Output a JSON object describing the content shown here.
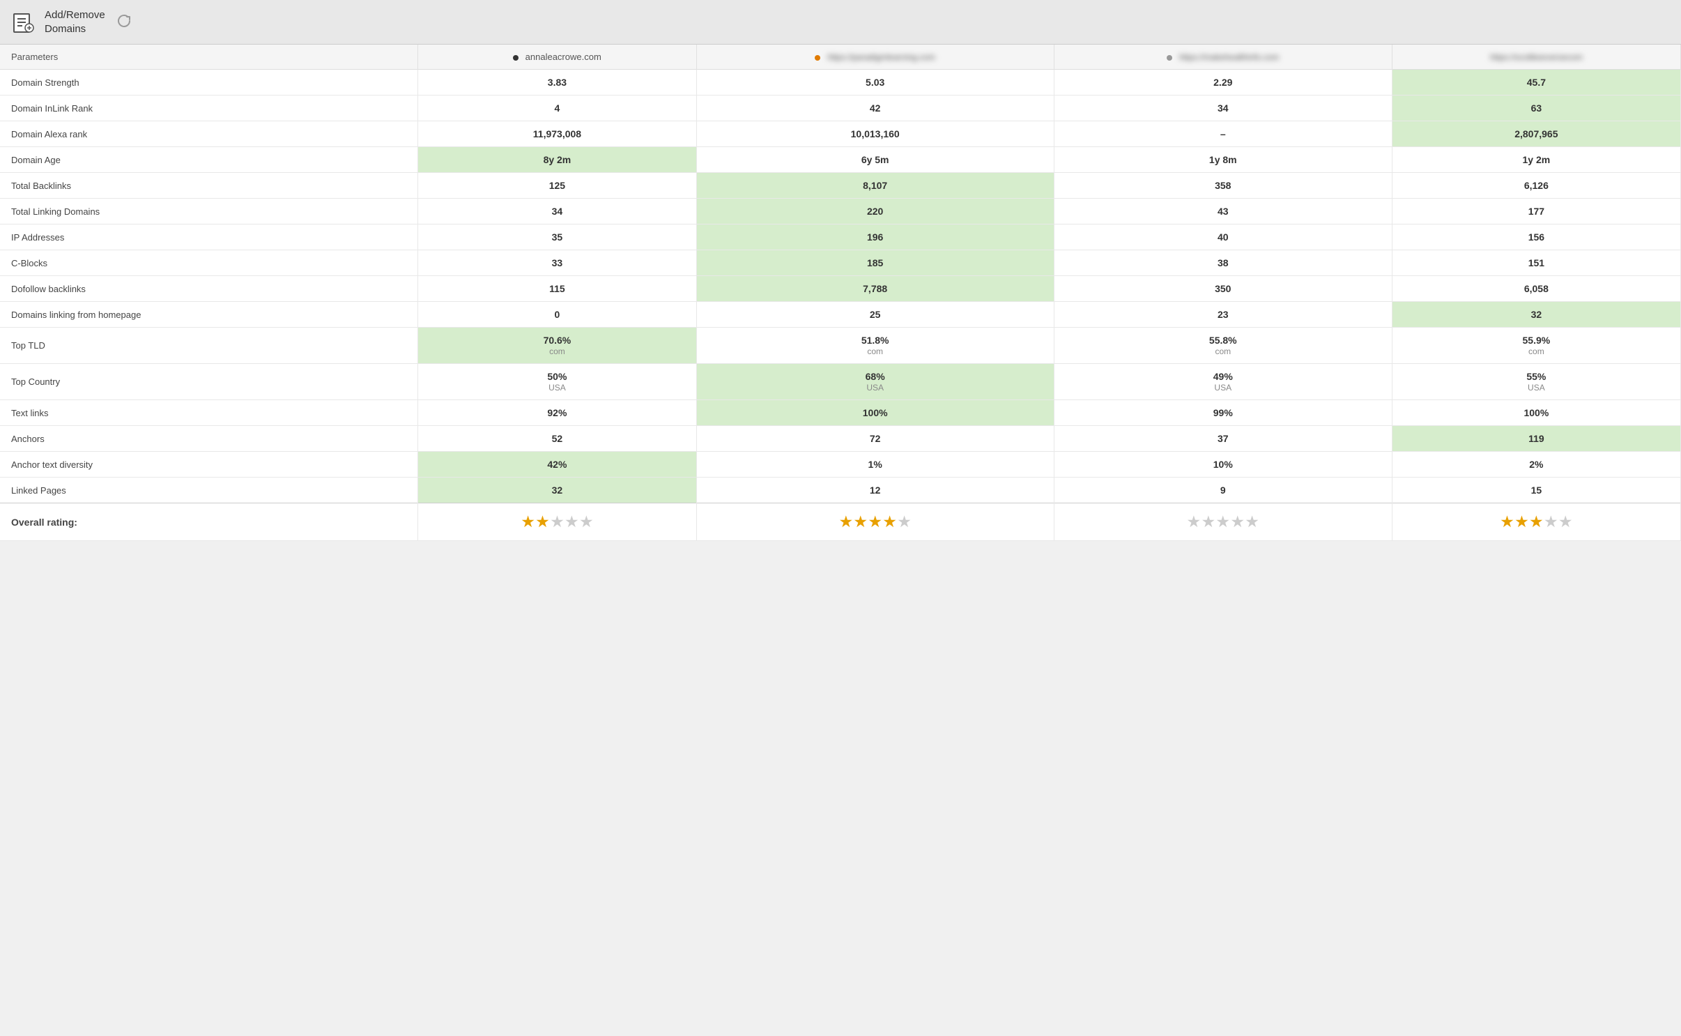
{
  "toolbar": {
    "title_line1": "Add/Remove",
    "title_line2": "Domains",
    "icon_label": "add-remove-domains-icon",
    "refresh_label": "refresh-icon"
  },
  "table": {
    "headers": {
      "parameters": "Parameters",
      "domain1": "annaleacrowe.com",
      "domain2": "https://paradigmlearning.com",
      "domain3": "https://makehealthinfo.com",
      "domain4": "https://scottkeeversecom"
    },
    "domain_dots": {
      "d1": "black",
      "d2": "orange",
      "d3": "gray",
      "d4": "none"
    },
    "rows": [
      {
        "param": "Domain Strength",
        "d1": "3.83",
        "d1_highlight": false,
        "d2": "5.03",
        "d2_highlight": false,
        "d3": "2.29",
        "d3_highlight": false,
        "d4": "45.7",
        "d4_highlight": true
      },
      {
        "param": "Domain InLink Rank",
        "d1": "4",
        "d1_highlight": false,
        "d2": "42",
        "d2_highlight": false,
        "d3": "34",
        "d3_highlight": false,
        "d4": "63",
        "d4_highlight": true
      },
      {
        "param": "Domain Alexa rank",
        "d1": "11,973,008",
        "d1_highlight": false,
        "d2": "10,013,160",
        "d2_highlight": false,
        "d3": "–",
        "d3_highlight": false,
        "d4": "2,807,965",
        "d4_highlight": true
      },
      {
        "param": "Domain Age",
        "d1": "8y 2m",
        "d1_highlight": true,
        "d2": "6y 5m",
        "d2_highlight": false,
        "d3": "1y 8m",
        "d3_highlight": false,
        "d4": "1y 2m",
        "d4_highlight": false
      },
      {
        "param": "Total Backlinks",
        "d1": "125",
        "d1_highlight": false,
        "d2": "8,107",
        "d2_highlight": true,
        "d3": "358",
        "d3_highlight": false,
        "d4": "6,126",
        "d4_highlight": false
      },
      {
        "param": "Total Linking Domains",
        "d1": "34",
        "d1_highlight": false,
        "d2": "220",
        "d2_highlight": true,
        "d3": "43",
        "d3_highlight": false,
        "d4": "177",
        "d4_highlight": false
      },
      {
        "param": "IP Addresses",
        "d1": "35",
        "d1_highlight": false,
        "d2": "196",
        "d2_highlight": true,
        "d3": "40",
        "d3_highlight": false,
        "d4": "156",
        "d4_highlight": false
      },
      {
        "param": "C-Blocks",
        "d1": "33",
        "d1_highlight": false,
        "d2": "185",
        "d2_highlight": true,
        "d3": "38",
        "d3_highlight": false,
        "d4": "151",
        "d4_highlight": false
      },
      {
        "param": "Dofollow backlinks",
        "d1": "115",
        "d1_highlight": false,
        "d2": "7,788",
        "d2_highlight": true,
        "d3": "350",
        "d3_highlight": false,
        "d4": "6,058",
        "d4_highlight": false
      },
      {
        "param": "Domains linking from homepage",
        "d1": "0",
        "d1_highlight": false,
        "d2": "25",
        "d2_highlight": false,
        "d3": "23",
        "d3_highlight": false,
        "d4": "32",
        "d4_highlight": true
      },
      {
        "param": "Top TLD",
        "d1": "70.6%",
        "d1_sub": "com",
        "d1_highlight": true,
        "d2": "51.8%",
        "d2_sub": "com",
        "d2_highlight": false,
        "d3": "55.8%",
        "d3_sub": "com",
        "d3_highlight": false,
        "d4": "55.9%",
        "d4_sub": "com",
        "d4_highlight": false
      },
      {
        "param": "Top Country",
        "d1": "50%",
        "d1_sub": "USA",
        "d1_highlight": false,
        "d2": "68%",
        "d2_sub": "USA",
        "d2_highlight": true,
        "d3": "49%",
        "d3_sub": "USA",
        "d3_highlight": false,
        "d4": "55%",
        "d4_sub": "USA",
        "d4_highlight": false
      },
      {
        "param": "Text links",
        "d1": "92%",
        "d1_highlight": false,
        "d2": "100%",
        "d2_highlight": true,
        "d3": "99%",
        "d3_highlight": false,
        "d4": "100%",
        "d4_highlight": false
      },
      {
        "param": "Anchors",
        "d1": "52",
        "d1_highlight": false,
        "d2": "72",
        "d2_highlight": false,
        "d3": "37",
        "d3_highlight": false,
        "d4": "119",
        "d4_highlight": true
      },
      {
        "param": "Anchor text diversity",
        "d1": "42%",
        "d1_highlight": true,
        "d2": "1%",
        "d2_highlight": false,
        "d3": "10%",
        "d3_highlight": false,
        "d4": "2%",
        "d4_highlight": false
      },
      {
        "param": "Linked Pages",
        "d1": "32",
        "d1_highlight": true,
        "d2": "12",
        "d2_highlight": false,
        "d3": "9",
        "d3_highlight": false,
        "d4": "15",
        "d4_highlight": false
      }
    ],
    "overall": {
      "label": "Overall rating:",
      "d1_stars": [
        true,
        true,
        false,
        false,
        false
      ],
      "d2_stars": [
        true,
        true,
        true,
        true,
        false
      ],
      "d3_stars": [
        false,
        false,
        false,
        false,
        false
      ],
      "d4_stars": [
        true,
        true,
        true,
        false,
        false
      ]
    }
  }
}
